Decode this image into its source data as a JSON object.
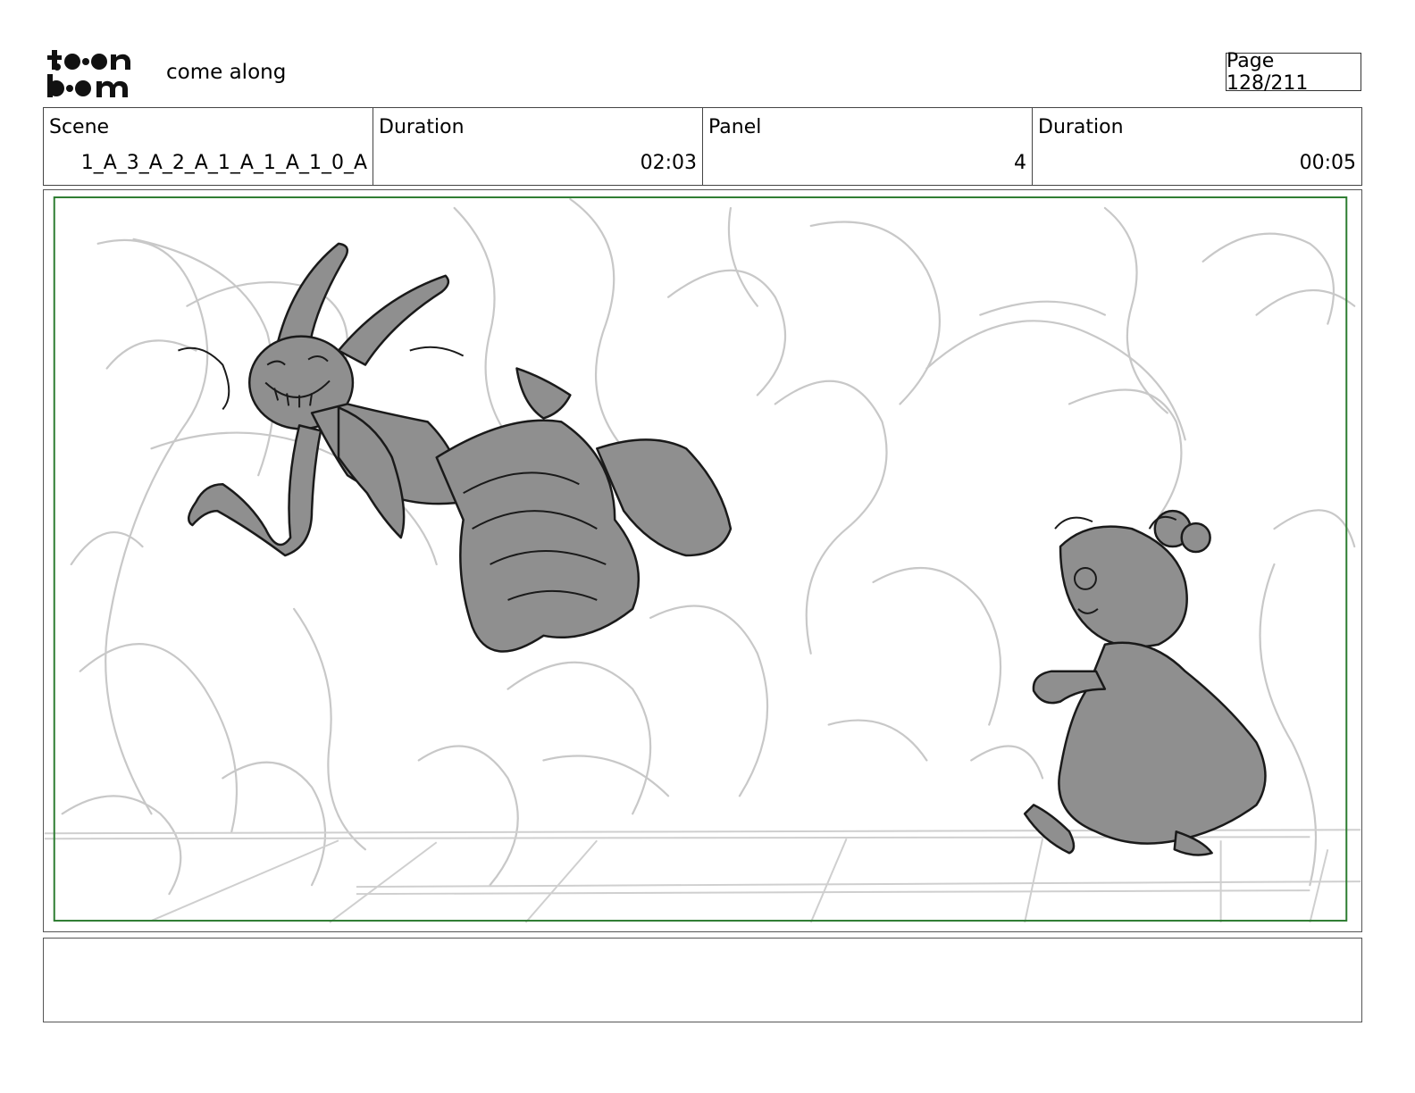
{
  "header": {
    "project_title": "come along",
    "page_label": "Page 128/211",
    "logo_text": "toon boom"
  },
  "info": {
    "scene_label": "Scene",
    "scene_value": "1_A_3_A_2_A_1_A_1_A_1_0_A",
    "scene_duration_label": "Duration",
    "scene_duration_value": "02:03",
    "panel_label": "Panel",
    "panel_value": "4",
    "panel_duration_label": "Duration",
    "panel_duration_value": "00:05"
  },
  "colors": {
    "safe_frame": "#2e7d32",
    "sketch_line": "#c8c8c8",
    "character_fill": "#8f8f8f",
    "ink": "#1a1a1a"
  },
  "notes": {
    "text": ""
  }
}
